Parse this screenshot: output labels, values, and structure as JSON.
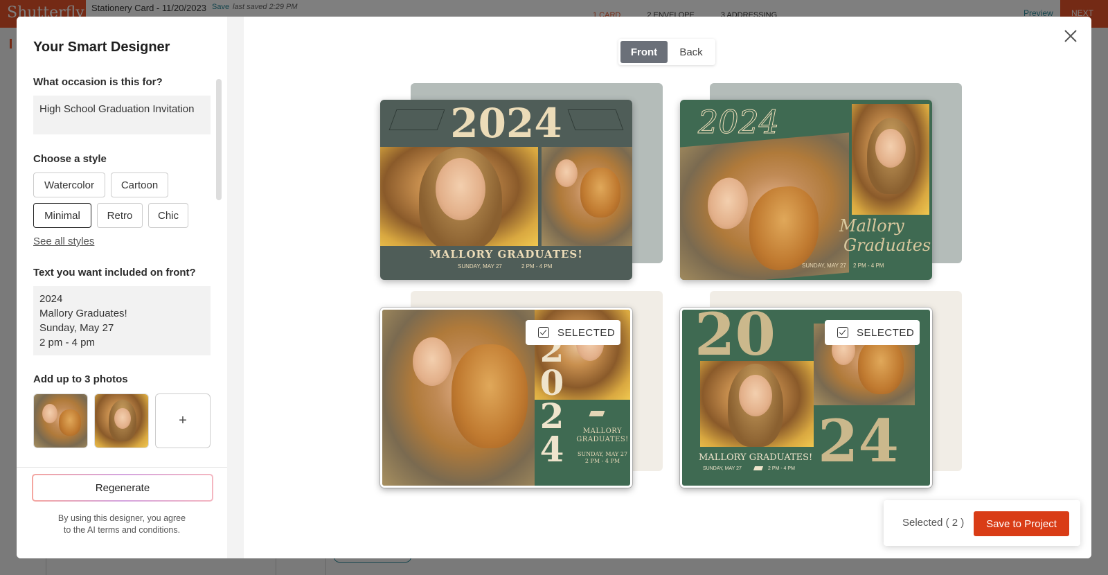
{
  "app": {
    "logo": "Shutterfly",
    "doc_title": "Stationery Card - 11/20/2023",
    "save_link": "Save",
    "last_saved": "last saved 2:29 PM",
    "steps": [
      "1 CARD",
      "2 ENVELOPE",
      "3 ADDRESSING"
    ],
    "preview": "Preview",
    "next": "NEXT"
  },
  "designer": {
    "title": "Your Smart Designer",
    "occasion_label": "What occasion is this for?",
    "occasion_value": "High School Graduation Invitation",
    "style_label": "Choose a style",
    "styles": [
      {
        "label": "Watercolor",
        "active": false
      },
      {
        "label": "Cartoon",
        "active": false
      },
      {
        "label": "Minimal",
        "active": true
      },
      {
        "label": "Retro",
        "active": false
      },
      {
        "label": "Chic",
        "active": false
      }
    ],
    "see_all": "See all styles",
    "text_label": "Text you want included on front?",
    "text_lines": [
      "2024",
      "Mallory Graduates!",
      "Sunday, May 27",
      "2 pm - 4 pm"
    ],
    "photos_label": "Add up to 3 photos",
    "add_photo": "+",
    "regenerate": "Regenerate",
    "terms_line1": "By using this designer, you agree",
    "terms_line2": "to the AI terms and conditions."
  },
  "view_toggle": {
    "front": "Front",
    "back": "Back",
    "selected": "Front"
  },
  "cards": [
    {
      "year": "2024",
      "headline": "MALLORY GRADUATES!",
      "date": "SUNDAY, MAY 27",
      "time": "2 PM - 4 PM",
      "selected": false
    },
    {
      "year": "2024",
      "headline": "Mallory",
      "headline2": "Graduates!",
      "date": "SUNDAY, MAY 27",
      "time": "2 PM - 4 PM",
      "selected": false
    },
    {
      "year_digits": [
        "2",
        "0",
        "2",
        "4"
      ],
      "headline": "MALLORY",
      "headline2": "GRADUATES!",
      "date": "SUNDAY, MAY 27",
      "time": "2 PM - 4 PM",
      "selected": true
    },
    {
      "year_top": "20",
      "year_bottom": "24",
      "headline": "MALLORY GRADUATES!",
      "date": "SUNDAY, MAY 27",
      "time": "2 PM - 4 PM",
      "selected": true
    }
  ],
  "selected_badge": "SELECTED",
  "footer": {
    "selected_label": "Selected ( 2 )",
    "save_button": "Save to Project"
  },
  "colors": {
    "accent": "#d93c16",
    "card_green_dark": "#4f5d58",
    "card_green": "#3f6a52",
    "toggle_active": "#6b7079"
  }
}
